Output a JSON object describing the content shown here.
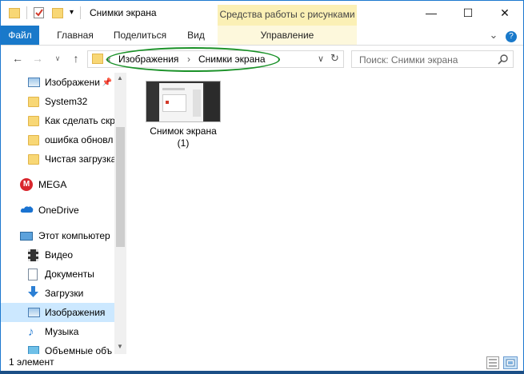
{
  "window": {
    "title": "Снимки экрана",
    "context_tab": "Средства работы с рисунками",
    "controls": {
      "minimize": "—",
      "maximize": "☐",
      "close": "✕"
    }
  },
  "ribbon": {
    "tabs": [
      "Файл",
      "Главная",
      "Поделиться",
      "Вид"
    ],
    "context_subtab": "Управление",
    "expand_glyph": "⌄",
    "help_glyph": "?"
  },
  "address": {
    "overflow": "«",
    "crumbs": [
      "Изображения",
      "Снимки экрана"
    ],
    "separator": "›",
    "search_placeholder": "Поиск: Снимки экрана"
  },
  "nav_pane": {
    "items": [
      {
        "label": "Изображени",
        "icon": "pictures-icon",
        "pinned": true
      },
      {
        "label": "System32",
        "icon": "folder-icon"
      },
      {
        "label": "Как сделать скр",
        "icon": "folder-icon"
      },
      {
        "label": "ошибка обновл",
        "icon": "folder-icon"
      },
      {
        "label": "Чистая загрузка",
        "icon": "folder-icon"
      },
      {
        "label": "MEGA",
        "icon": "mega-icon"
      },
      {
        "label": "OneDrive",
        "icon": "onedrive-icon"
      },
      {
        "label": "Этот компьютер",
        "icon": "computer-icon"
      },
      {
        "label": "Видео",
        "icon": "video-icon"
      },
      {
        "label": "Документы",
        "icon": "documents-icon"
      },
      {
        "label": "Загрузки",
        "icon": "downloads-icon"
      },
      {
        "label": "Изображения",
        "icon": "pictures-icon",
        "selected": true
      },
      {
        "label": "Музыка",
        "icon": "music-icon"
      },
      {
        "label": "Объемные объ",
        "icon": "3d-objects-icon"
      }
    ]
  },
  "content": {
    "files": [
      {
        "name_line1": "Снимок экрана",
        "name_line2": "(1)"
      }
    ]
  },
  "status": {
    "count_text": "1 элемент"
  },
  "colors": {
    "accent": "#1979ca",
    "context_tab": "#fbf0b5",
    "selected": "#cce8ff",
    "annotation": "#1a9128"
  }
}
